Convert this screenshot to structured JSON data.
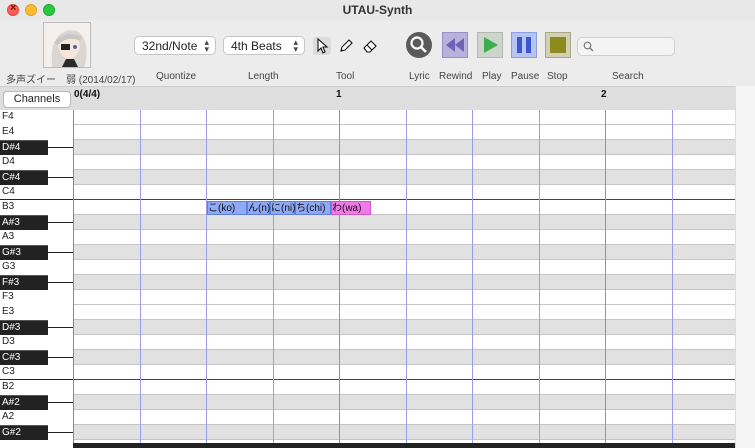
{
  "window": {
    "title": "UTAU-Synth"
  },
  "toolbar": {
    "singer_name": "多声ズイー　弱 (2014/02/17)",
    "quantize_value": "32nd/Note",
    "length_value": "4th Beats",
    "search_placeholder": "",
    "labels": {
      "quantize": "Quontize",
      "length": "Length",
      "tool": "Tool",
      "lyric": "Lyric",
      "rewind": "Rewind",
      "play": "Play",
      "pause": "Pause",
      "stop": "Stop",
      "search": "Search"
    },
    "icons": {
      "zoom": "magnifier-icon",
      "rewind": "rewind-icon",
      "play": "play-icon",
      "pause": "pause-icon",
      "stop": "stop-icon",
      "arrow_tool": "arrow-cursor-icon",
      "pencil_tool": "pencil-icon",
      "eraser_tool": "eraser-icon"
    }
  },
  "header": {
    "channels_label": "Channels",
    "measures": [
      "0(4/4)",
      "1",
      "2"
    ]
  },
  "piano_keys": [
    {
      "name": "F4",
      "black": false
    },
    {
      "name": "E4",
      "black": false
    },
    {
      "name": "D#4",
      "black": true
    },
    {
      "name": "D4",
      "black": false
    },
    {
      "name": "C#4",
      "black": true
    },
    {
      "name": "C4",
      "black": false
    },
    {
      "name": "B3",
      "black": false
    },
    {
      "name": "A#3",
      "black": true
    },
    {
      "name": "A3",
      "black": false
    },
    {
      "name": "G#3",
      "black": true
    },
    {
      "name": "G3",
      "black": false
    },
    {
      "name": "F#3",
      "black": true
    },
    {
      "name": "F3",
      "black": false
    },
    {
      "name": "E3",
      "black": false
    },
    {
      "name": "D#3",
      "black": true
    },
    {
      "name": "D3",
      "black": false
    },
    {
      "name": "C#3",
      "black": true
    },
    {
      "name": "C3",
      "black": false
    },
    {
      "name": "B2",
      "black": false
    },
    {
      "name": "A#2",
      "black": true
    },
    {
      "name": "A2",
      "black": false
    },
    {
      "name": "G#2",
      "black": true
    }
  ],
  "notes": [
    {
      "lyric": "こ(ko)",
      "pitch": "B3",
      "color": "blue"
    },
    {
      "lyric": "ん(n)",
      "pitch": "B3",
      "color": "blue"
    },
    {
      "lyric": "に(ni)",
      "pitch": "B3",
      "color": "blue"
    },
    {
      "lyric": "ち(chi)",
      "pitch": "B3",
      "color": "blue"
    },
    {
      "lyric": "わ(wa)",
      "pitch": "B3",
      "color": "pink"
    }
  ],
  "colors": {
    "note_blue": "#8fa9f5",
    "note_pink": "#f27ae8",
    "beat_line": "#9b9bf0",
    "measure_line": "#e060e0",
    "start_line": "#f06060"
  }
}
